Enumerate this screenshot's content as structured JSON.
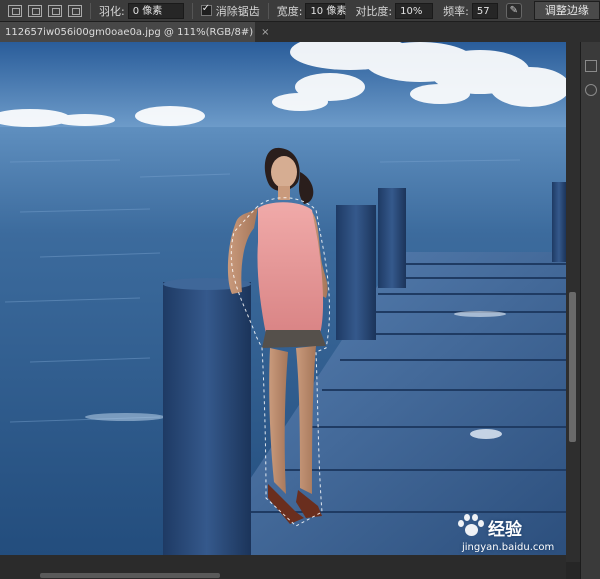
{
  "options_bar": {
    "feather_label": "羽化:",
    "feather_value": "0 像素",
    "antialias_label": "消除锯齿",
    "antialias_checked": true,
    "width_label": "宽度:",
    "width_value": "10 像素",
    "contrast_label": "对比度:",
    "contrast_value": "10%",
    "frequency_label": "频率:",
    "frequency_value": "57",
    "refine_edge_label": "调整边缘"
  },
  "document_tab": {
    "title": "112657iw056i00gm0oae0a.jpg @ 111%(RGB/8#)",
    "close_glyph": "×"
  },
  "watermark": {
    "name": "经验",
    "url": "jingyan.baidu.com"
  },
  "colors": {
    "sky": "#3b6fa8",
    "sea": "#2c5c8f",
    "pier": "#27456e",
    "dress": "#e79a9c"
  },
  "icons": [
    "selection-mode-icon",
    "stylus-pressure-icon",
    "baidu-paw-icon"
  ]
}
